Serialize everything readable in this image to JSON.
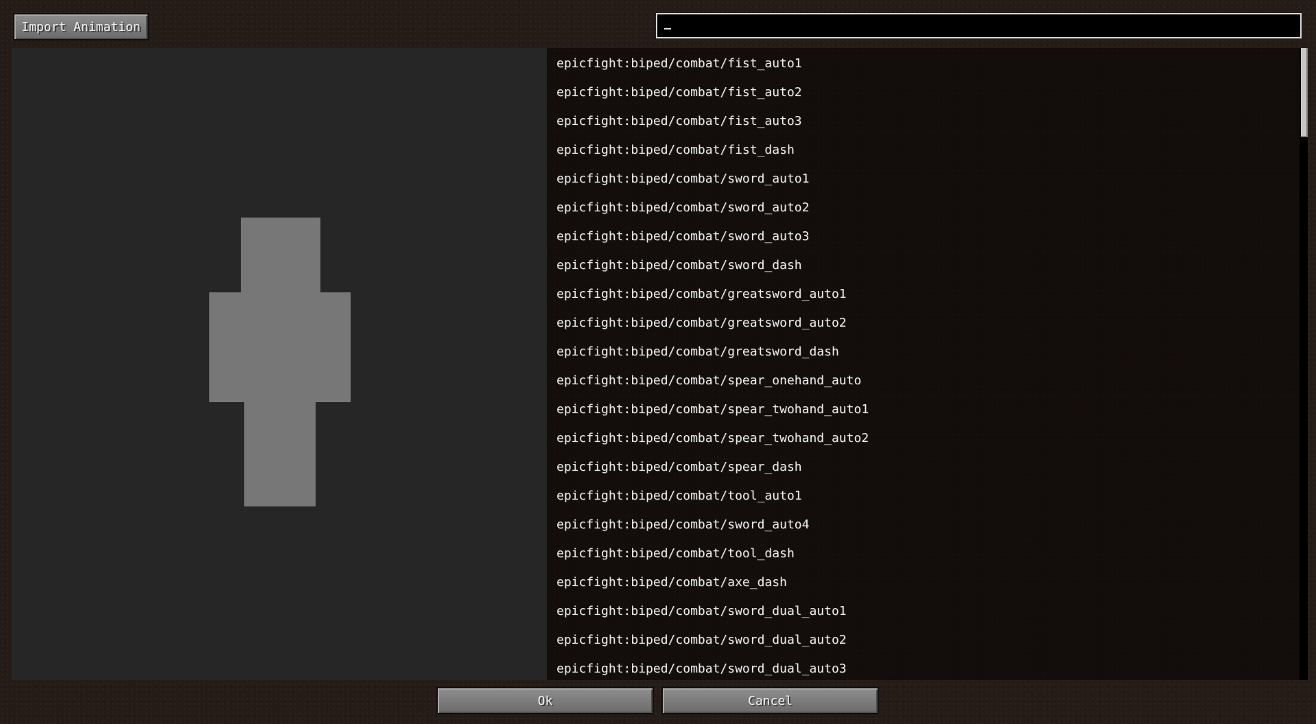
{
  "toolbar": {
    "import_label": "Import Animation"
  },
  "search": {
    "value": ""
  },
  "animations": [
    "epicfight:biped/combat/fist_auto1",
    "epicfight:biped/combat/fist_auto2",
    "epicfight:biped/combat/fist_auto3",
    "epicfight:biped/combat/fist_dash",
    "epicfight:biped/combat/sword_auto1",
    "epicfight:biped/combat/sword_auto2",
    "epicfight:biped/combat/sword_auto3",
    "epicfight:biped/combat/sword_dash",
    "epicfight:biped/combat/greatsword_auto1",
    "epicfight:biped/combat/greatsword_auto2",
    "epicfight:biped/combat/greatsword_dash",
    "epicfight:biped/combat/spear_onehand_auto",
    "epicfight:biped/combat/spear_twohand_auto1",
    "epicfight:biped/combat/spear_twohand_auto2",
    "epicfight:biped/combat/spear_dash",
    "epicfight:biped/combat/tool_auto1",
    "epicfight:biped/combat/sword_auto4",
    "epicfight:biped/combat/tool_dash",
    "epicfight:biped/combat/axe_dash",
    "epicfight:biped/combat/sword_dual_auto1",
    "epicfight:biped/combat/sword_dual_auto2",
    "epicfight:biped/combat/sword_dual_auto3"
  ],
  "footer": {
    "ok_label": "Ok",
    "cancel_label": "Cancel"
  },
  "colors": {
    "preview_bg": "#262626",
    "model": "#777777",
    "list_text": "#ececec"
  }
}
